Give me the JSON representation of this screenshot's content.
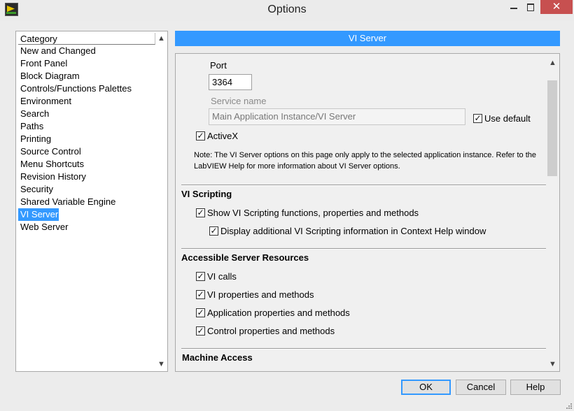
{
  "window": {
    "title": "Options",
    "minimize_icon": "minimize-icon",
    "maximize_icon": "maximize-icon",
    "close_icon": "close-icon",
    "close_symbol": "✕"
  },
  "category": {
    "header": "Category",
    "items": [
      "New and Changed",
      "Front Panel",
      "Block Diagram",
      "Controls/Functions Palettes",
      "Environment",
      "Search",
      "Paths",
      "Printing",
      "Source Control",
      "Menu Shortcuts",
      "Revision History",
      "Security",
      "Shared Variable Engine",
      "VI Server",
      "Web Server"
    ],
    "selected": "VI Server"
  },
  "page": {
    "banner": "VI Server",
    "port_label": "Port",
    "port_value": "3364",
    "service_label": "Service name",
    "service_value": "Main Application Instance/VI Server",
    "use_default_label": "Use default",
    "use_default_checked": true,
    "activex_label": "ActiveX",
    "activex_checked": true,
    "note_line1": "Note: The VI Server options on this page only apply to the selected application instance. Refer to the",
    "note_line2": "LabVIEW Help for more information about VI Server options.",
    "scripting_title": "VI Scripting",
    "scripting_show_label": "Show VI Scripting functions, properties and methods",
    "scripting_display_label": "Display additional VI Scripting information in Context Help window",
    "resources_title": "Accessible Server Resources",
    "resources": [
      "VI calls",
      "VI properties and methods",
      "Application properties and methods",
      "Control properties and methods"
    ],
    "machine_title": "Machine Access"
  },
  "buttons": {
    "ok": "OK",
    "cancel": "Cancel",
    "help": "Help"
  },
  "colors": {
    "accent": "#3399ff",
    "close_button": "#c75050"
  }
}
